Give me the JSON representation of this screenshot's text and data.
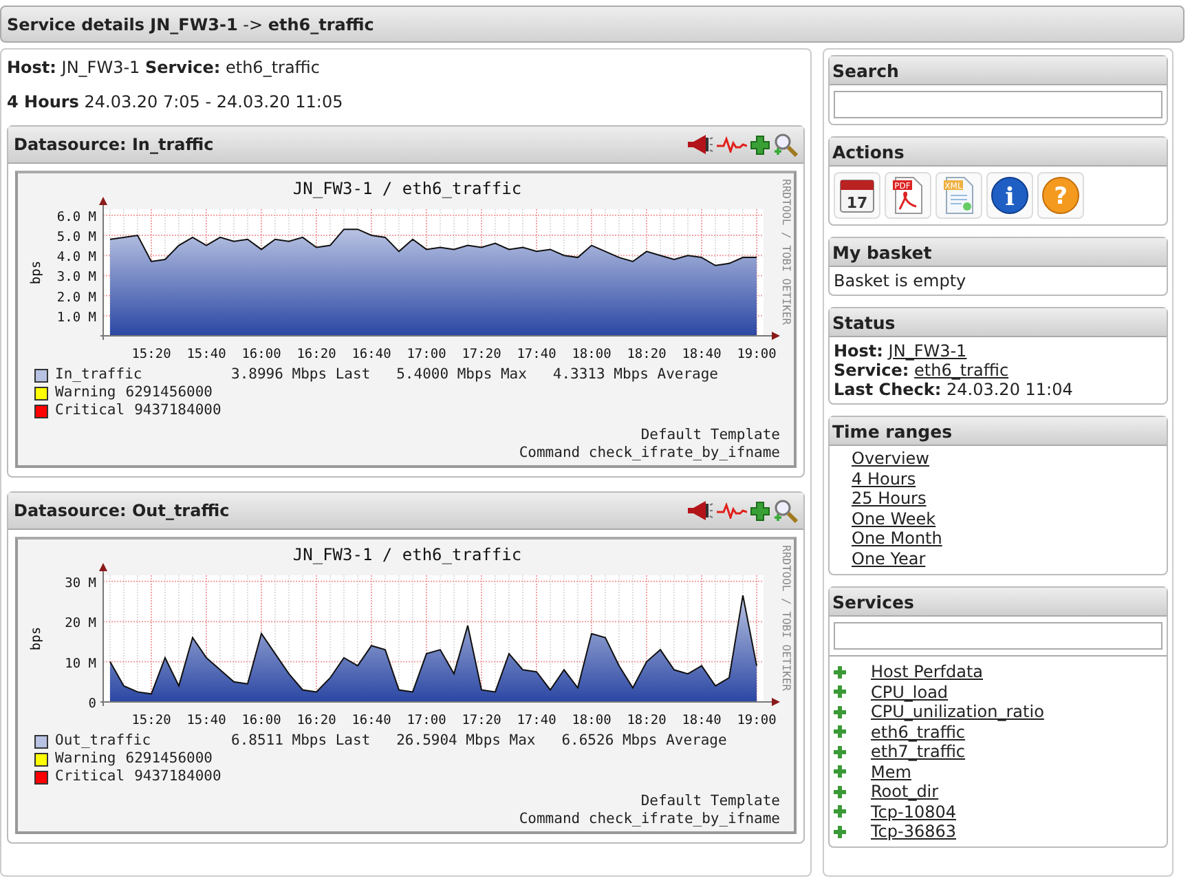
{
  "header": {
    "title": "**Service details JN_FW3-1** -> **eth6_traffic**"
  },
  "info": {
    "host_line": "**Host:** JN_FW3-1 **Service:** eth6_traffic",
    "range_line": "**4 Hours** 24.03.20 7:05 - 24.03.20 11:05"
  },
  "datasources": [
    {
      "title": "Datasource: In_traffic",
      "graph": {
        "watermark": "RRDTOOL / TOBI OETIKER",
        "legend": [
          {
            "kind": "series",
            "text": "3.8996 Mbps Last   5.4000 Mbps Max   4.3313 Mbps Average",
            "color": "#b8c2e2"
          },
          {
            "kind": "threshold",
            "label": "Warning",
            "text": "6291456000",
            "color": "#ffff00"
          },
          {
            "kind": "threshold",
            "label": "Critical",
            "text": "9437184000",
            "color": "#ff0000"
          }
        ],
        "template": "Default Template",
        "command": "Command check_ifrate_by_ifname",
        "chart_data": {
          "type": "area",
          "title": "JN_FW3-1 / eth6_traffic",
          "ylabel": "bps",
          "categories": [
            null,
            null,
            null,
            "15:20",
            null,
            null,
            null,
            "15:40",
            null,
            null,
            null,
            "16:00",
            null,
            null,
            null,
            "16:20",
            null,
            null,
            null,
            "16:40",
            null,
            null,
            null,
            "17:00",
            null,
            null,
            null,
            "17:20",
            null,
            null,
            null,
            "17:40",
            null,
            null,
            null,
            "18:00",
            null,
            null,
            null,
            "18:20",
            null,
            null,
            null,
            "18:40",
            null,
            null,
            null,
            "19:00"
          ],
          "series": [
            {
              "name": "In_traffic",
              "color": "#b8c2e2",
              "values": [
                4.8,
                4.9,
                5.0,
                3.7,
                3.8,
                4.5,
                4.9,
                4.5,
                4.9,
                4.7,
                4.8,
                4.3,
                4.8,
                4.7,
                4.9,
                4.4,
                4.5,
                5.3,
                5.3,
                5.0,
                4.9,
                4.2,
                4.8,
                4.3,
                4.4,
                4.3,
                4.5,
                4.4,
                4.6,
                4.3,
                4.4,
                4.2,
                4.3,
                4.0,
                3.9,
                4.5,
                4.2,
                3.9,
                3.7,
                4.2,
                4.0,
                3.8,
                4.0,
                3.9,
                3.5,
                3.6,
                3.9,
                3.9
              ]
            }
          ],
          "ylim": [
            0,
            6.3
          ],
          "grid": true,
          "yticks": [
            {
              "value": 1,
              "label": "1.0 M"
            },
            {
              "value": 2,
              "label": "2.0 M"
            },
            {
              "value": 3,
              "label": "3.0 M"
            },
            {
              "value": 4,
              "label": "4.0 M"
            },
            {
              "value": 5,
              "label": "5.0 M"
            },
            {
              "value": 6,
              "label": "6.0 M"
            }
          ]
        }
      }
    },
    {
      "title": "Datasource: Out_traffic",
      "graph": {
        "watermark": "RRDTOOL / TOBI OETIKER",
        "legend": [
          {
            "kind": "series",
            "text": "6.8511 Mbps Last   26.5904 Mbps Max   6.6526 Mbps Average",
            "color": "#b8c2e2"
          },
          {
            "kind": "threshold",
            "label": "Warning",
            "text": "6291456000",
            "color": "#ffff00"
          },
          {
            "kind": "threshold",
            "label": "Critical",
            "text": "9437184000",
            "color": "#ff0000"
          }
        ],
        "template": "Default Template",
        "command": "Command check_ifrate_by_ifname",
        "chart_data": {
          "type": "area",
          "title": "JN_FW3-1 / eth6_traffic",
          "ylabel": "bps",
          "categories": [
            null,
            null,
            null,
            "15:20",
            null,
            null,
            null,
            "15:40",
            null,
            null,
            null,
            "16:00",
            null,
            null,
            null,
            "16:20",
            null,
            null,
            null,
            "16:40",
            null,
            null,
            null,
            "17:00",
            null,
            null,
            null,
            "17:20",
            null,
            null,
            null,
            "17:40",
            null,
            null,
            null,
            "18:00",
            null,
            null,
            null,
            "18:20",
            null,
            null,
            null,
            "18:40",
            null,
            null,
            null,
            "19:00"
          ],
          "series": [
            {
              "name": "Out_traffic",
              "color": "#b8c2e2",
              "values": [
                10,
                4,
                2.5,
                2,
                11,
                4,
                16,
                11,
                8,
                5,
                4.5,
                17,
                12,
                7,
                3,
                2.5,
                6,
                11,
                9,
                14,
                13,
                3,
                2.5,
                12,
                13,
                7,
                19,
                3,
                2.5,
                12,
                8,
                7.5,
                3,
                8,
                3.5,
                17,
                16,
                9,
                3.5,
                10,
                13,
                8,
                7,
                9,
                4,
                6,
                26.5,
                9
              ]
            }
          ],
          "ylim": [
            0,
            31.5
          ],
          "grid": true,
          "yticks": [
            {
              "value": 0,
              "label": "0"
            },
            {
              "value": 10,
              "label": "10 M"
            },
            {
              "value": 20,
              "label": "20 M"
            },
            {
              "value": 30,
              "label": "30 M"
            }
          ]
        }
      }
    }
  ],
  "sidebar": [
    {
      "kind": "search",
      "title": "Search"
    },
    {
      "kind": "actions",
      "title": "Actions",
      "icons": [
        {
          "kind": "calendar",
          "label": "17"
        },
        {
          "kind": "pdf",
          "label": "PDF"
        },
        {
          "kind": "xml",
          "label": "XML"
        },
        {
          "kind": "info",
          "label": "i"
        },
        {
          "kind": "help",
          "label": "?"
        }
      ]
    },
    {
      "kind": "text",
      "title": "My basket",
      "text": "Basket is empty"
    },
    {
      "kind": "status",
      "title": "Status",
      "rows": [
        {
          "label": "Host:",
          "value": "JN_FW3-1",
          "link": true
        },
        {
          "label": "Service:",
          "value": "eth6_traffic",
          "link": true
        },
        {
          "label": "Last Check:",
          "value": "24.03.20 11:04",
          "link": false
        }
      ]
    },
    {
      "kind": "links",
      "title": "Time ranges",
      "links": [
        "Overview",
        "4 Hours",
        "25 Hours",
        "One Week",
        "One Month",
        "One Year"
      ]
    },
    {
      "kind": "services",
      "title": "Services",
      "items": [
        "Host Perfdata",
        "CPU_load",
        "CPU_unilization_ratio",
        "eth6_traffic",
        "eth7_traffic",
        "Mem",
        "Root_dir",
        "Tcp-10804",
        "Tcp-36863"
      ]
    }
  ]
}
